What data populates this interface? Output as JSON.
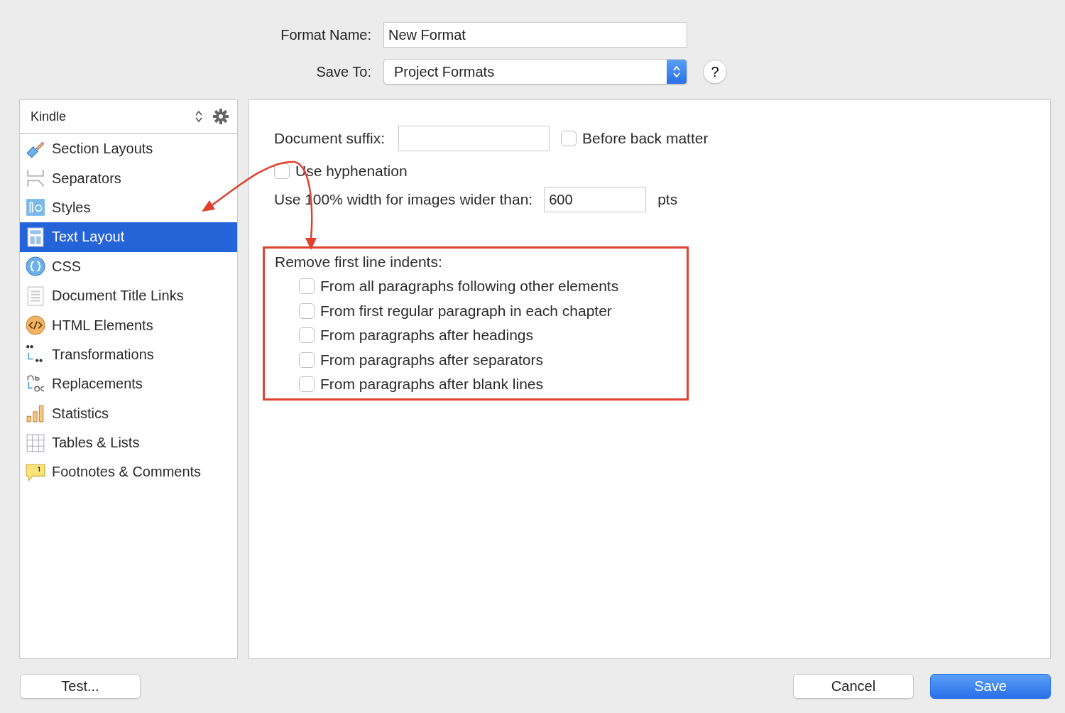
{
  "format_name": {
    "label": "Format Name:",
    "value": "New Format"
  },
  "save_to": {
    "label": "Save To:",
    "value": "Project Formats"
  },
  "help_button": {
    "label": "?"
  },
  "sidebar": {
    "format": "Kindle",
    "items": [
      {
        "label": "Section Layouts",
        "kind": "brush",
        "selected": false
      },
      {
        "label": "Separators",
        "kind": "separator",
        "selected": false
      },
      {
        "label": "Styles",
        "kind": "styles",
        "selected": false
      },
      {
        "label": "Text Layout",
        "kind": "layout",
        "selected": true
      },
      {
        "label": "CSS",
        "kind": "css",
        "selected": false
      },
      {
        "label": "Document Title Links",
        "kind": "document",
        "selected": false
      },
      {
        "label": "HTML Elements",
        "kind": "html",
        "selected": false
      },
      {
        "label": "Transformations",
        "kind": "quotes",
        "selected": false
      },
      {
        "label": "Replacements",
        "kind": "replace",
        "selected": false
      },
      {
        "label": "Statistics",
        "kind": "bars",
        "selected": false
      },
      {
        "label": "Tables & Lists",
        "kind": "table",
        "selected": false
      },
      {
        "label": "Footnotes & Comments",
        "kind": "note",
        "selected": false
      }
    ]
  },
  "settings": {
    "document_suffix": {
      "label": "Document suffix:"
    },
    "before_back_matter": {
      "label": "Before back matter",
      "checked": false
    },
    "use_hyphenation": {
      "label": "Use hyphenation",
      "checked": false
    },
    "image_width": {
      "label": "Use 100% width for images wider than:",
      "value": "600",
      "unit": "pts"
    },
    "indents": {
      "title": "Remove first line indents:",
      "options": [
        {
          "label": "From all paragraphs following other elements",
          "checked": false
        },
        {
          "label": "From first regular paragraph in each chapter",
          "checked": false
        },
        {
          "label": "From paragraphs after headings",
          "checked": false
        },
        {
          "label": "From paragraphs after separators",
          "checked": false
        },
        {
          "label": "From paragraphs after blank lines",
          "checked": false
        }
      ]
    }
  },
  "buttons": {
    "test": "Test...",
    "cancel": "Cancel",
    "save": "Save"
  }
}
